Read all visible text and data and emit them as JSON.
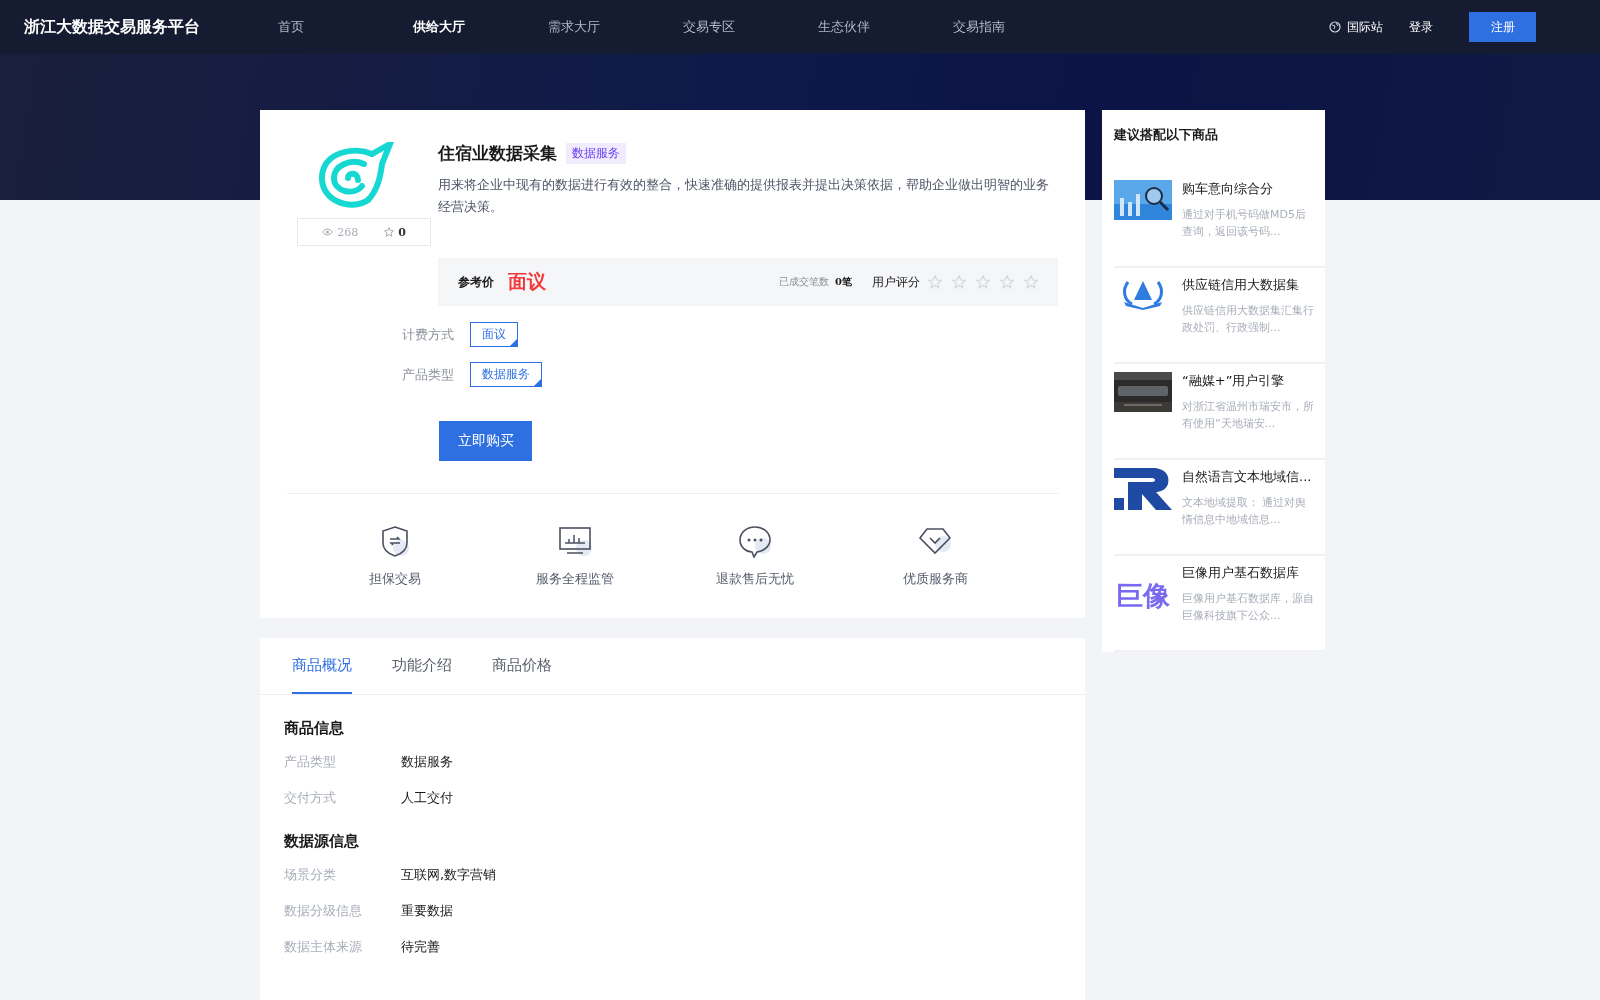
{
  "header": {
    "brand": "浙江大数据交易服务平台",
    "nav": [
      {
        "label": "首页",
        "selected": false
      },
      {
        "label": "供给大厅",
        "selected": true
      },
      {
        "label": "需求大厅",
        "selected": false
      },
      {
        "label": "交易专区",
        "selected": false
      },
      {
        "label": "生态伙伴",
        "selected": false
      },
      {
        "label": "交易指南",
        "selected": false
      }
    ],
    "intl": "国际站",
    "login": "登录",
    "register": "注册"
  },
  "product": {
    "views": "268",
    "favorites": "0",
    "title": "住宿业数据采集",
    "tag": "数据服务",
    "description": "用来将企业中现有的数据进行有效的整合，快速准确的提供报表并提出决策依据，帮助企业做出明智的业务经营决策。",
    "price_label": "参考价",
    "price": "面议",
    "deals_label": "已成交笔数",
    "deals": "0笔",
    "rating_label": "用户评分",
    "stars": 0,
    "options": [
      {
        "label": "计费方式",
        "value": "面议"
      },
      {
        "label": "产品类型",
        "value": "数据服务"
      }
    ],
    "buy": "立即购买",
    "guarantees": [
      {
        "kind": "shield",
        "label": "担保交易"
      },
      {
        "kind": "monitor",
        "label": "服务全程监管"
      },
      {
        "kind": "chat",
        "label": "退款售后无忧"
      },
      {
        "kind": "diamond",
        "label": "优质服务商"
      }
    ]
  },
  "tabs": [
    {
      "label": "商品概况",
      "selected": true
    },
    {
      "label": "功能介绍",
      "selected": false
    },
    {
      "label": "商品价格",
      "selected": false
    }
  ],
  "sections": [
    {
      "title": "商品信息",
      "rows": [
        {
          "label": "产品类型",
          "value": "数据服务"
        },
        {
          "label": "交付方式",
          "value": "人工交付"
        }
      ]
    },
    {
      "title": "数据源信息",
      "rows": [
        {
          "label": "场景分类",
          "value": "互联网,数字营销"
        },
        {
          "label": "数据分级信息",
          "value": "重要数据"
        },
        {
          "label": "数据主体来源",
          "value": "待完善"
        }
      ]
    }
  ],
  "sidebar": {
    "title": "建议搭配以下商品",
    "items": [
      {
        "title": "购车意向综合分",
        "description": "通过对手机号码做MD5后查询，返回该号码..."
      },
      {
        "kind": "badge",
        "title": "供应链信用大数据集",
        "description": "供应链信用大数据集汇集行政处罚、行政强制..."
      },
      {
        "kind": "photo-dark",
        "title": "“融媒+”用户引擎",
        "description": "对浙江省温州市瑞安市，所有使用“天地瑞安..."
      },
      {
        "kind": "mark",
        "title": "自然语言文本地域信...",
        "description": "文本地域提取： 通过对舆情信息中地域信息..."
      },
      {
        "kind": "wordmark",
        "wordmark": "巨像",
        "title": "巨像用户基石数据库",
        "description": "巨像用户基石数据库，源自巨像科技旗下公众..."
      }
    ]
  }
}
